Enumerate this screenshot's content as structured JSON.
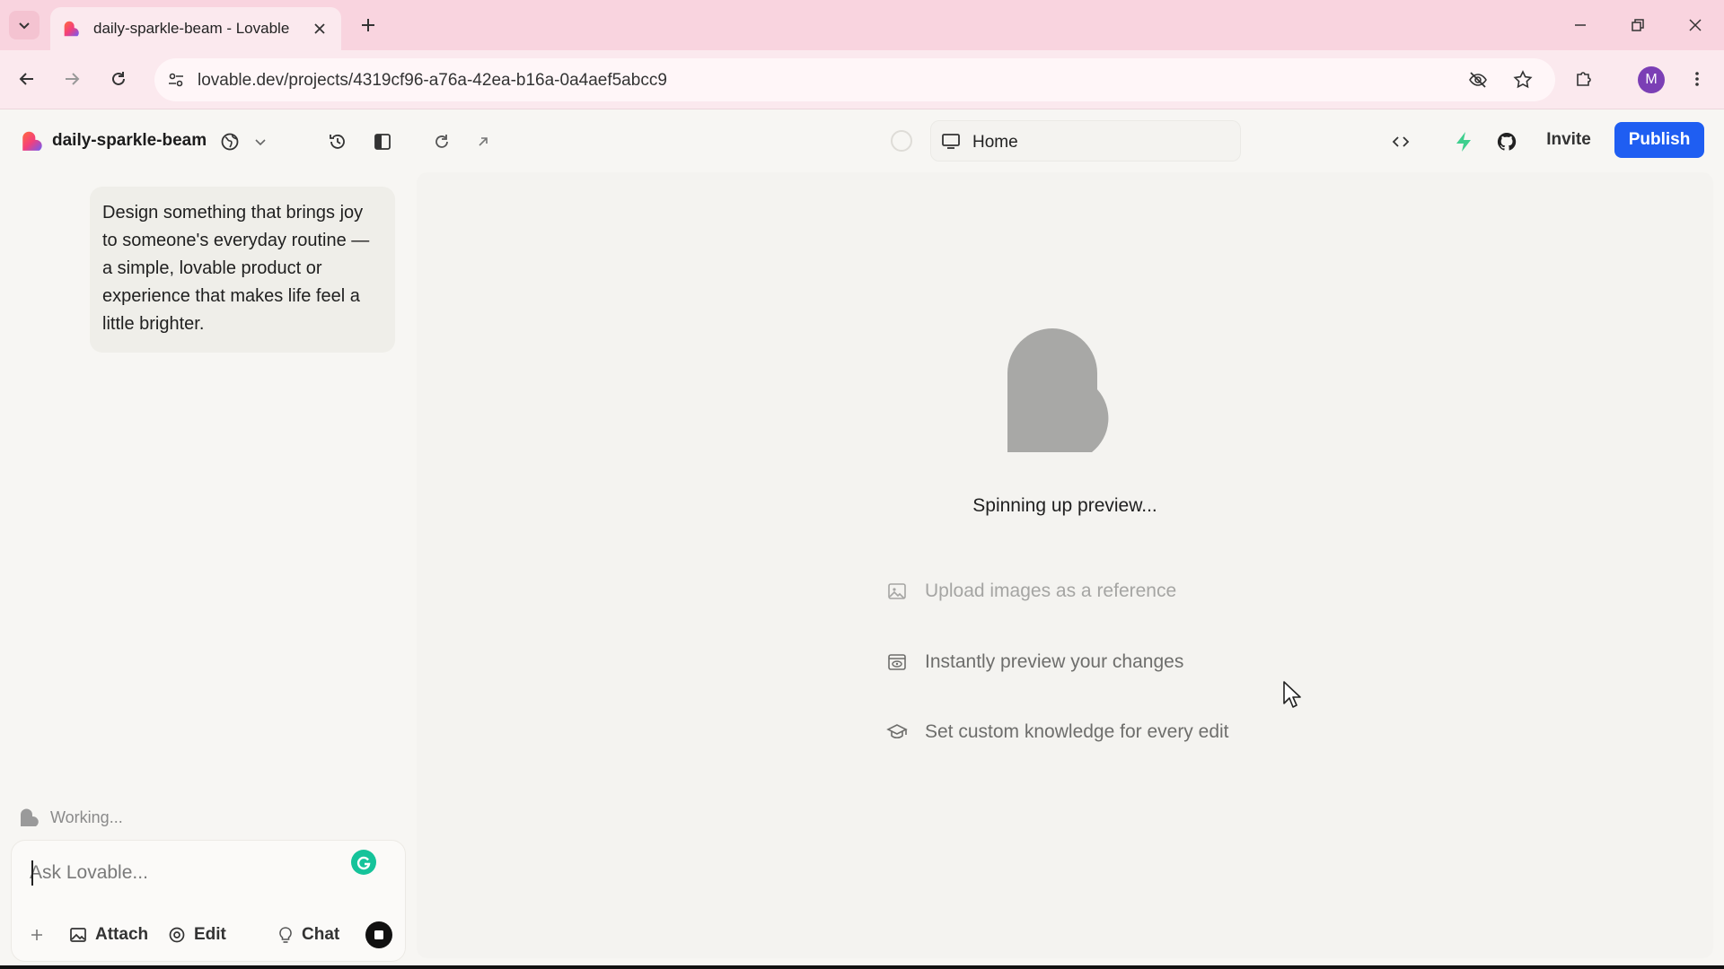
{
  "browser": {
    "tab_title": "daily-sparkle-beam - Lovable",
    "url": "lovable.dev/projects/4319cf96-a76a-42ea-b16a-0a4aef5abcc9",
    "profile_initial": "M",
    "tabstrip_color": "#f9d4df"
  },
  "header": {
    "project_name": "daily-sparkle-beam",
    "route": "Home",
    "invite_label": "Invite",
    "publish_label": "Publish",
    "accent_color": "#1f5ef2"
  },
  "chat": {
    "prompt": "Design something that brings joy to someone's everyday routine — a simple, lovable product or experience that makes life feel a little brighter.",
    "status": "Working...",
    "input_value": "",
    "input_placeholder": "Ask Lovable...",
    "attach_label": "Attach",
    "edit_label": "Edit",
    "chat_label": "Chat"
  },
  "preview": {
    "status": "Spinning up preview...",
    "tips": [
      {
        "icon": "image-icon",
        "text": "Upload images as a reference"
      },
      {
        "icon": "preview-window-icon",
        "text": "Instantly preview your changes"
      },
      {
        "icon": "graduation-cap-icon",
        "text": "Set custom knowledge for every edit"
      }
    ]
  }
}
